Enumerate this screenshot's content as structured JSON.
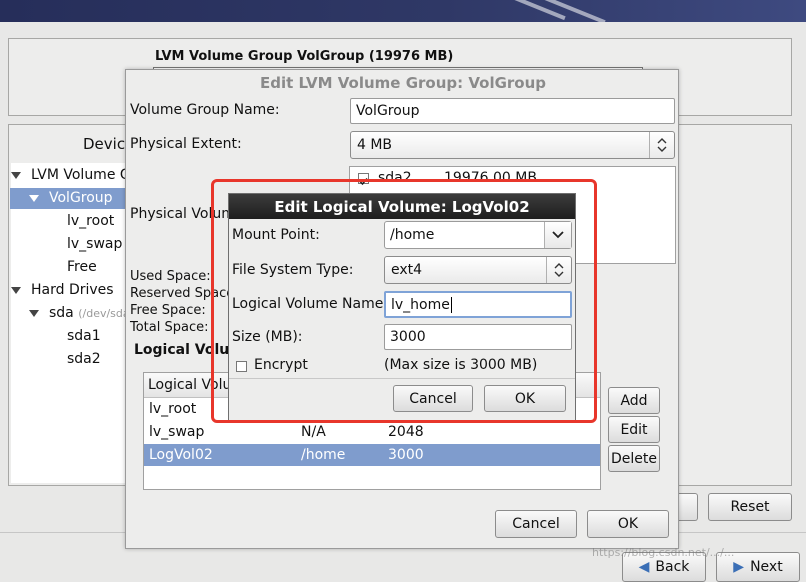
{
  "main": {
    "lvm_title": "LVM Volume Group VolGroup (19976 MB)",
    "device_label": "Device",
    "tree": [
      {
        "label": "LVM Volume G",
        "note": ""
      },
      {
        "label": "VolGroup",
        "note": ""
      },
      {
        "label": "lv_root",
        "note": ""
      },
      {
        "label": "lv_swap",
        "note": ""
      },
      {
        "label": "Free",
        "note": ""
      },
      {
        "label": "Hard Drives",
        "note": ""
      },
      {
        "label": "sda",
        "note": "(/dev/sda"
      },
      {
        "label": "sda1",
        "note": ""
      },
      {
        "label": "sda2",
        "note": ""
      }
    ],
    "reset_label": "Reset",
    "back_label": "Back",
    "next_label": "Next"
  },
  "vg_dialog": {
    "title": "Edit LVM Volume Group: VolGroup",
    "vg_name_label": "Volume Group Name:",
    "vg_name_value": "VolGroup",
    "pe_label": "Physical Extent:",
    "pe_value": "4 MB",
    "pv_label": "Physical Volum",
    "pv_item_name": "sda2",
    "pv_item_size": "19976.00 MB",
    "used_space": "Used Space:",
    "reserved_space": "Reserved Space",
    "free_space": "Free Space:",
    "total_space": "Total Space:",
    "lv_section_label": "Logical Volu",
    "lv_col_name": "Logical Volu",
    "lv_rows": [
      {
        "name": "lv_root",
        "mount": "",
        "size": ""
      },
      {
        "name": "lv_swap",
        "mount": "N/A",
        "size": "2048"
      },
      {
        "name": "LogVol02",
        "mount": "/home",
        "size": "3000"
      }
    ],
    "add_label": "Add",
    "edit_label": "Edit",
    "delete_label": "Delete",
    "cancel_label": "Cancel",
    "ok_label": "OK"
  },
  "lv_dialog": {
    "title": "Edit Logical Volume: LogVol02",
    "mount_label": "Mount Point:",
    "mount_value": "/home",
    "fs_label": "File System Type:",
    "fs_value": "ext4",
    "lvname_label": "Logical Volume Name:",
    "lvname_value": "lv_home",
    "size_label": "Size (MB):",
    "size_value": "3000",
    "encrypt_label": "Encrypt",
    "max_size": "(Max size is 3000 MB)",
    "cancel_label": "Cancel",
    "ok_label": "OK"
  },
  "colors": {
    "highlight_box": "#e8362b",
    "selection": "#7f9ccd"
  },
  "watermark": "https://blog.csdn.net/.../..."
}
